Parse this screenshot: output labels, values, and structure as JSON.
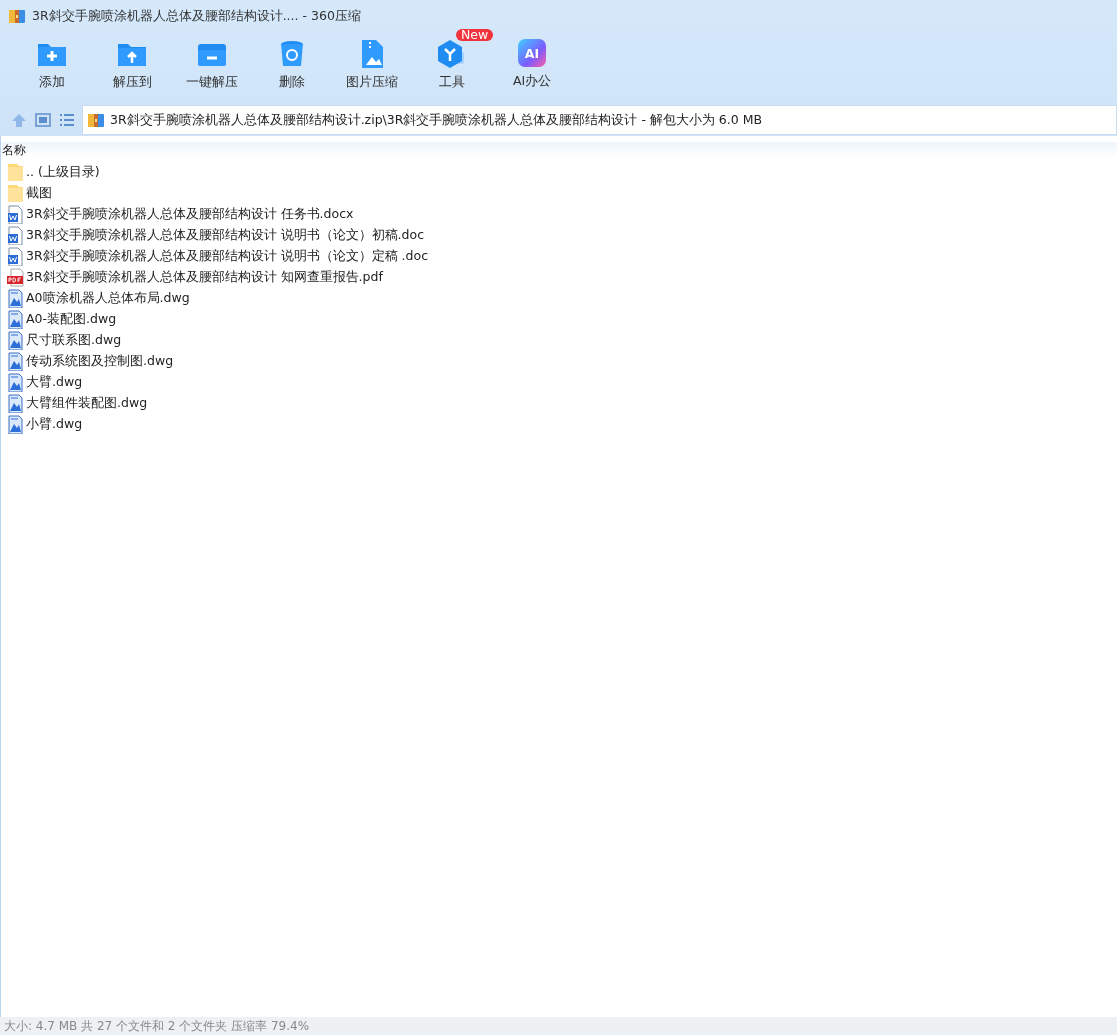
{
  "window": {
    "title": "3R斜交手腕喷涂机器人总体及腰部结构设计.... - 360压缩"
  },
  "toolbar": [
    {
      "label": "添加",
      "kind": "add"
    },
    {
      "label": "解压到",
      "kind": "extract"
    },
    {
      "label": "一键解压",
      "kind": "oneclick"
    },
    {
      "label": "删除",
      "kind": "delete"
    },
    {
      "label": "图片压缩",
      "kind": "image"
    },
    {
      "label": "工具",
      "kind": "tools",
      "badge": "New"
    },
    {
      "label": "AI办公",
      "kind": "ai",
      "icon_text": "AI"
    }
  ],
  "address": {
    "path": "3R斜交手腕喷涂机器人总体及腰部结构设计.zip\\3R斜交手腕喷涂机器人总体及腰部结构设计 - 解包大小为 6.0 MB"
  },
  "table": {
    "columns": [
      "名称"
    ],
    "rows": [
      {
        "name": ".. (上级目录)",
        "kind": "folder"
      },
      {
        "name": "截图",
        "kind": "folder"
      },
      {
        "name": "3R斜交手腕喷涂机器人总体及腰部结构设计 任务书.docx",
        "kind": "word"
      },
      {
        "name": "3R斜交手腕喷涂机器人总体及腰部结构设计 说明书（论文）初稿.doc",
        "kind": "word"
      },
      {
        "name": "3R斜交手腕喷涂机器人总体及腰部结构设计 说明书（论文）定稿 .doc",
        "kind": "word"
      },
      {
        "name": "3R斜交手腕喷涂机器人总体及腰部结构设计 知网查重报告.pdf",
        "kind": "pdf"
      },
      {
        "name": "A0喷涂机器人总体布局.dwg",
        "kind": "dwg"
      },
      {
        "name": "A0-装配图.dwg",
        "kind": "dwg"
      },
      {
        "name": "尺寸联系图.dwg",
        "kind": "dwg"
      },
      {
        "name": "传动系统图及控制图.dwg",
        "kind": "dwg"
      },
      {
        "name": "大臂.dwg",
        "kind": "dwg"
      },
      {
        "name": "大臂组件装配图.dwg",
        "kind": "dwg"
      },
      {
        "name": "小臂.dwg",
        "kind": "dwg"
      }
    ]
  },
  "status_bar": "大小: 4.7 MB 共 27 个文件和 2 个文件夹 压缩率 79.4%"
}
